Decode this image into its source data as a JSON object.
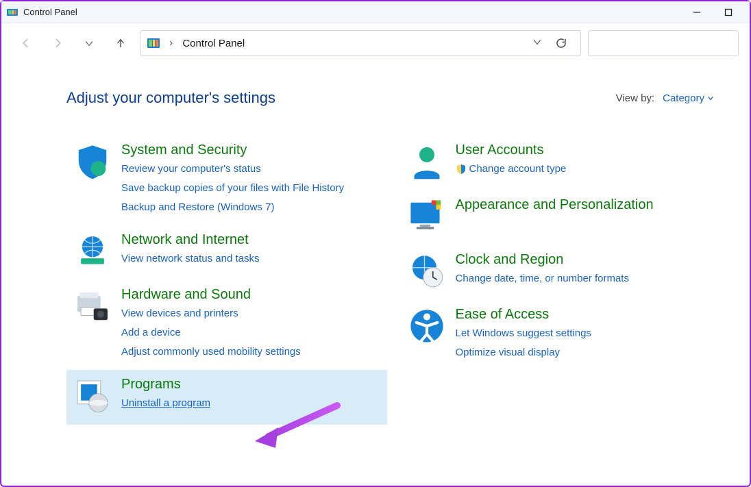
{
  "window": {
    "title": "Control Panel"
  },
  "breadcrumb": {
    "root": "Control Panel"
  },
  "header": {
    "title": "Adjust your computer's settings"
  },
  "viewby": {
    "label": "View by:",
    "value": "Category"
  },
  "left": [
    {
      "title": "System and Security",
      "links": [
        "Review your computer's status",
        "Save backup copies of your files with File History",
        "Backup and Restore (Windows 7)"
      ]
    },
    {
      "title": "Network and Internet",
      "links": [
        "View network status and tasks"
      ]
    },
    {
      "title": "Hardware and Sound",
      "links": [
        "View devices and printers",
        "Add a device",
        "Adjust commonly used mobility settings"
      ]
    },
    {
      "title": "Programs",
      "links": [
        "Uninstall a program"
      ]
    }
  ],
  "right": [
    {
      "title": "User Accounts",
      "links": [
        "Change account type"
      ],
      "shield": true
    },
    {
      "title": "Appearance and Personalization",
      "links": []
    },
    {
      "title": "Clock and Region",
      "links": [
        "Change date, time, or number formats"
      ]
    },
    {
      "title": "Ease of Access",
      "links": [
        "Let Windows suggest settings",
        "Optimize visual display"
      ]
    }
  ]
}
